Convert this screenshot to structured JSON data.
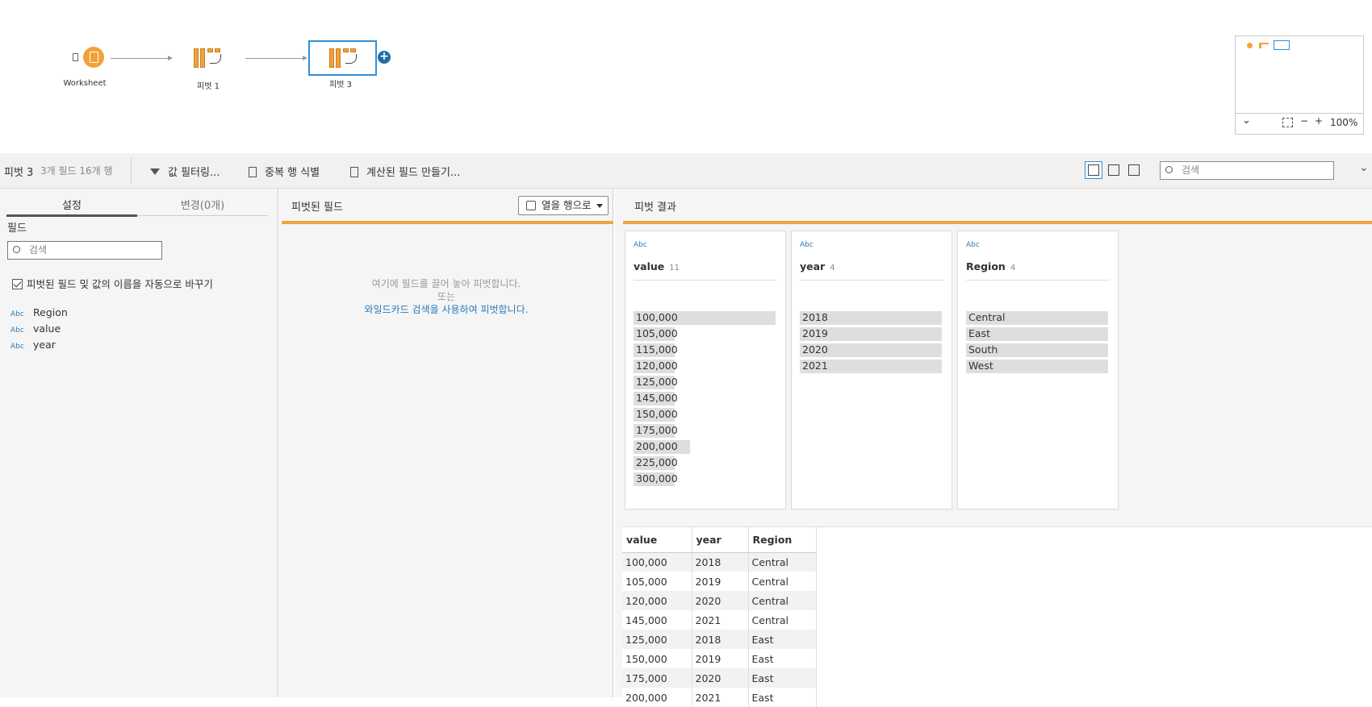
{
  "flow": {
    "nodes": [
      {
        "label": "Worksheet"
      },
      {
        "label": "피벗 1"
      },
      {
        "label": "피벗 3"
      }
    ],
    "zoom": "100%"
  },
  "toolbar": {
    "step_name": "피벗 3",
    "summary": "3개 필드  16개 행",
    "filter_label": "값 필터링...",
    "dupe_label": "중복 행 식별",
    "calc_label": "계산된 필드 만들기...",
    "search_placeholder": "검색"
  },
  "left": {
    "tabs": [
      "설정",
      "변경(0개)"
    ],
    "fields_title": "필드",
    "search_placeholder": "검색",
    "auto_rename_label": "피벗된 필드 및 값의 이름을 자동으로 바꾸기",
    "fields": [
      {
        "type": "Abc",
        "name": "Region"
      },
      {
        "type": "Abc",
        "name": "value"
      },
      {
        "type": "Abc",
        "name": "year"
      }
    ]
  },
  "middle": {
    "title": "피벗된 필드",
    "dropdown_label": "열을 행으로",
    "empty_line1": "여기에 필드를 끌어 놓아 피벗합니다.",
    "empty_line2": "또는",
    "empty_link": "와일드카드 검색을 사용하여 피벗합니다."
  },
  "right": {
    "title": "피벗 결과",
    "cards": [
      {
        "type": "Abc",
        "name": "value",
        "count": "11",
        "values": [
          {
            "v": "100,000",
            "frac": 1.0
          },
          {
            "v": "105,000",
            "frac": 0.29
          },
          {
            "v": "115,000",
            "frac": 0.29
          },
          {
            "v": "120,000",
            "frac": 0.29
          },
          {
            "v": "125,000",
            "frac": 0.29
          },
          {
            "v": "145,000",
            "frac": 0.29
          },
          {
            "v": "150,000",
            "frac": 0.29
          },
          {
            "v": "175,000",
            "frac": 0.29
          },
          {
            "v": "200,000",
            "frac": 0.4
          },
          {
            "v": "225,000",
            "frac": 0.29
          },
          {
            "v": "300,000",
            "frac": 0.29
          }
        ]
      },
      {
        "type": "Abc",
        "name": "year",
        "count": "4",
        "values": [
          {
            "v": "2018",
            "frac": 1.0
          },
          {
            "v": "2019",
            "frac": 1.0
          },
          {
            "v": "2020",
            "frac": 1.0
          },
          {
            "v": "2021",
            "frac": 1.0
          }
        ]
      },
      {
        "type": "Abc",
        "name": "Region",
        "count": "4",
        "values": [
          {
            "v": "Central",
            "frac": 1.0
          },
          {
            "v": "East",
            "frac": 1.0
          },
          {
            "v": "South",
            "frac": 1.0
          },
          {
            "v": "West",
            "frac": 1.0
          }
        ]
      }
    ],
    "table": {
      "columns": [
        "value",
        "year",
        "Region"
      ],
      "rows": [
        [
          "100,000",
          "2018",
          "Central"
        ],
        [
          "105,000",
          "2019",
          "Central"
        ],
        [
          "120,000",
          "2020",
          "Central"
        ],
        [
          "145,000",
          "2021",
          "Central"
        ],
        [
          "125,000",
          "2018",
          "East"
        ],
        [
          "150,000",
          "2019",
          "East"
        ],
        [
          "175,000",
          "2020",
          "East"
        ],
        [
          "200,000",
          "2021",
          "East"
        ]
      ]
    }
  },
  "colors": {
    "accent": "#f2a23a",
    "selection": "#2f8fd8",
    "link": "#2b7bb9"
  }
}
